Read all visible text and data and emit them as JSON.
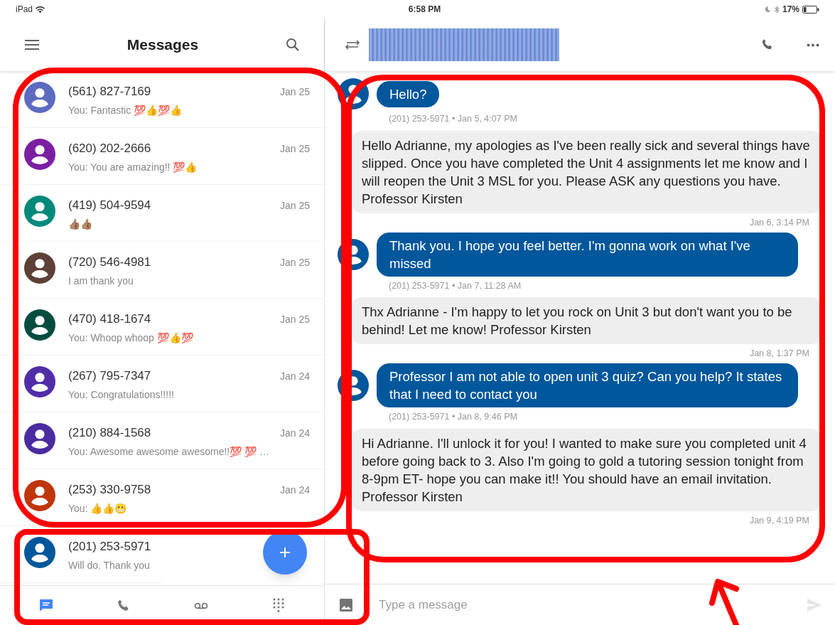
{
  "status_bar": {
    "device": "iPad",
    "time": "6:58 PM",
    "battery": "17%"
  },
  "conversations_panel": {
    "title": "Messages",
    "conversations": [
      {
        "name": "(561) 827-7169",
        "preview": "You: Fantastic 💯👍💯👍",
        "date": "Jan 25",
        "color": "#5c6bc0"
      },
      {
        "name": "(620) 202-2666",
        "preview": "You: You are amazing!! 💯👍",
        "date": "Jan 25",
        "color": "#7b1fa2"
      },
      {
        "name": "(419) 504-9594",
        "preview": "👍🏽👍🏽",
        "date": "Jan 25",
        "color": "#00897b"
      },
      {
        "name": "(720) 546-4981",
        "preview": "I am thank you",
        "date": "Jan 25",
        "color": "#5d4037"
      },
      {
        "name": "(470) 418-1674",
        "preview": "You: Whoop whoop 💯👍💯",
        "date": "Jan 25",
        "color": "#004d40"
      },
      {
        "name": "(267) 795-7347",
        "preview": "You: Congratulations!!!!!",
        "date": "Jan 24",
        "color": "#512da8"
      },
      {
        "name": "(210) 884-1568",
        "preview": "You: Awesome awesome awesome!!💯 💯 …",
        "date": "Jan 24",
        "color": "#4a2ca0"
      },
      {
        "name": "(253) 330-9758",
        "preview": "You: 👍👍😬",
        "date": "Jan 24",
        "color": "#bf360c"
      },
      {
        "name": "(201) 253-5971",
        "preview": "Will do. Thank you",
        "color": "#01579b"
      }
    ],
    "nav_tabs": [
      {
        "kind": "messages",
        "selected": true
      },
      {
        "kind": "calls",
        "selected": false
      },
      {
        "kind": "voicemail",
        "selected": false
      },
      {
        "kind": "dialpad",
        "selected": false
      }
    ]
  },
  "conversation": {
    "messages": [
      {
        "kind": "outgoing",
        "text": "Hello?",
        "meta": "(201) 253-5971 • Jan 5, 4:07 PM"
      },
      {
        "kind": "incoming",
        "text": "Hello Adrianne, my apologies as I've been really sick and several things have slipped. Once you have completed the Unit 4 assignments let me know and I will reopen the Unit 3 MSL for you. Please ASK any questions you have. Professor Kirsten",
        "meta": "Jan 6, 3:14 PM"
      },
      {
        "kind": "outgoing",
        "text": "Thank you. I hope you feel better.  I'm gonna work on what I've missed",
        "meta": "(201) 253-5971 • Jan 7, 11:28 AM"
      },
      {
        "kind": "incoming",
        "text": "Thx Adrianne - I'm happy to let you rock on Unit 3 but don't want you to be behind! Let me know! Professor Kirsten",
        "meta": "Jan 8, 1:37 PM"
      },
      {
        "kind": "outgoing",
        "text": "Professor I am not able to open unit 3 quiz? Can you help? It states that I need to contact you",
        "meta": "(201) 253-5971 • Jan 8, 9:46 PM"
      },
      {
        "kind": "incoming",
        "text": "Hi Adrianne. I'll unlock it for you! I wanted to make sure you completed unit 4 before going back to 3. Also I'm going to gold a tutoring session tonight from 8-9pm ET- hope you can make it!! You should have an email invitation.\nProfessor Kirsten",
        "meta": "Jan 9, 4:19 PM"
      }
    ],
    "compose": {
      "placeholder": "Type a message"
    }
  },
  "annotations": [
    {
      "kind": "outline"
    },
    {
      "kind": "outline"
    },
    {
      "kind": "outline"
    },
    {
      "kind": "arrow"
    }
  ]
}
